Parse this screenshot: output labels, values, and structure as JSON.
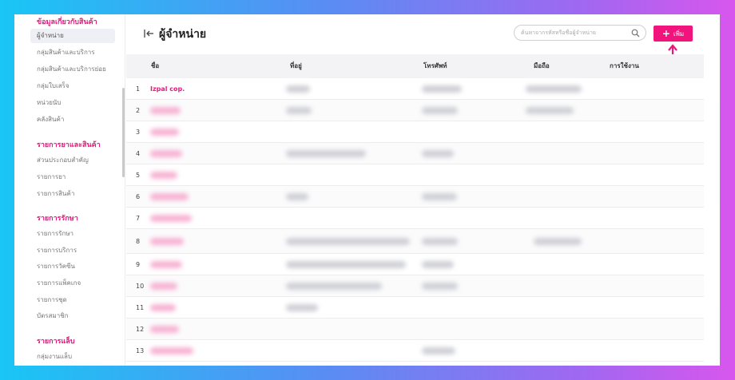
{
  "sidebar": {
    "sections": [
      {
        "title": "ข้อมูลเกี่ยวกับสินค้า",
        "items": [
          "ผู้จำหน่าย",
          "กลุ่มสินค้าและบริการ",
          "กลุ่มสินค้าและบริการย่อย",
          "กลุ่มใบเสร็จ",
          "หน่วยนับ",
          "คลังสินค้า"
        ],
        "active": 0
      },
      {
        "title": "รายการยาและสินค้า",
        "items": [
          "ส่วนประกอบสำคัญ",
          "รายการยา",
          "รายการสินค้า"
        ]
      },
      {
        "title": "รายการรักษา",
        "items": [
          "รายการรักษา",
          "รายการบริการ",
          "รายการวัคซีน",
          "รายการแพ็คเกจ",
          "รายการชุด",
          "บัตรสมาชิก"
        ]
      },
      {
        "title": "รายการแล็บ",
        "items": [
          "กลุ่มงานแล็บ"
        ]
      }
    ]
  },
  "header": {
    "title": "ผู้จำหน่าย",
    "search_placeholder": "ค้นหาจากรหัสหรือชื่อผู้จำหน่าย",
    "add_label": "เพิ่ม"
  },
  "table": {
    "columns": [
      "ชื่อ",
      "ที่อยู่",
      "โทรศัพท์",
      "มือถือ",
      "การใช้งาน"
    ],
    "rows": [
      {
        "no": "1",
        "name": "Izpal cop."
      },
      {
        "no": "2",
        "name": ""
      },
      {
        "no": "3",
        "name": ""
      },
      {
        "no": "4",
        "name": ""
      },
      {
        "no": "5",
        "name": ""
      },
      {
        "no": "6",
        "name": ""
      },
      {
        "no": "7",
        "name": ""
      },
      {
        "no": "8",
        "name": ""
      },
      {
        "no": "9",
        "name": ""
      },
      {
        "no": "10",
        "name": ""
      },
      {
        "no": "11",
        "name": ""
      },
      {
        "no": "12",
        "name": ""
      },
      {
        "no": "13",
        "name": ""
      }
    ]
  },
  "colors": {
    "accent": "#f0147c",
    "section_title": "#e8197e"
  },
  "icons": {
    "back": "collapse-left-icon",
    "search": "search-icon",
    "add": "plus-icon",
    "annotation": "arrow-up-icon"
  }
}
